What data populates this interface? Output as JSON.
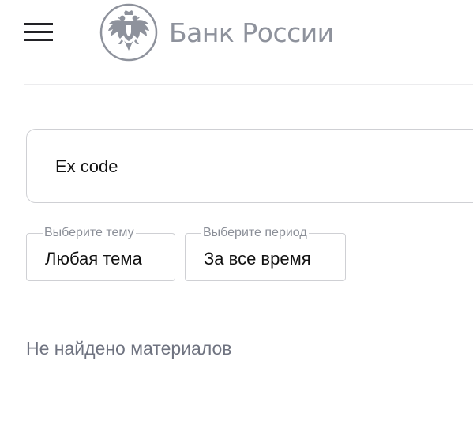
{
  "header": {
    "menu_icon": "hamburger-menu-icon",
    "logo_icon": "double-headed-eagle-emblem",
    "logo_text": "Банк России"
  },
  "search": {
    "value": "Ex code"
  },
  "filters": {
    "theme": {
      "legend": "Выберите тему",
      "value": "Любая тема"
    },
    "period": {
      "legend": "Выберите период",
      "value": "За все время"
    }
  },
  "results": {
    "empty_message": "Не найдено материалов"
  },
  "colors": {
    "logo_gray": "#8e929c",
    "border": "#cfd0d4",
    "text": "#111111",
    "muted": "#6f7380"
  }
}
